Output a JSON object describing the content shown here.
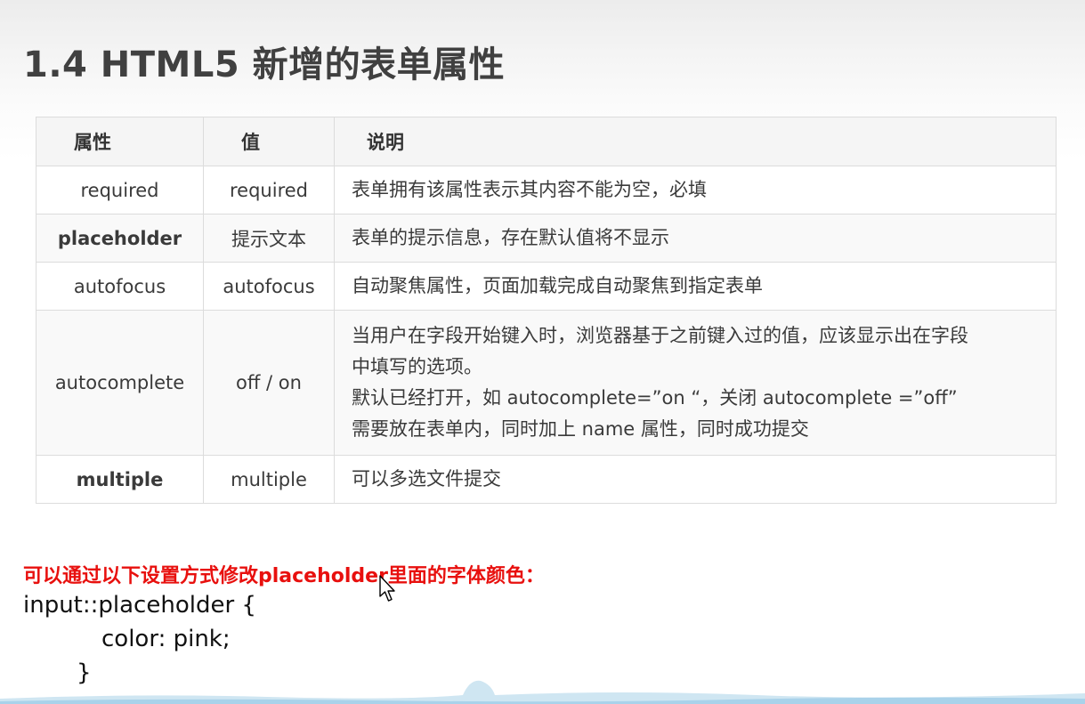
{
  "title": "1.4 HTML5 新增的表单属性",
  "table": {
    "headers": [
      "属性",
      "值",
      "说明"
    ],
    "rows": [
      {
        "attr": "required",
        "value": "required",
        "desc": [
          "表单拥有该属性表示其内容不能为空，必填"
        ],
        "bold": false
      },
      {
        "attr": "placeholder",
        "value": "提示文本",
        "desc": [
          "表单的提示信息，存在默认值将不显示"
        ],
        "bold": true
      },
      {
        "attr": "autofocus",
        "value": "autofocus",
        "desc": [
          "自动聚焦属性，页面加载完成自动聚焦到指定表单"
        ],
        "bold": false
      },
      {
        "attr": "autocomplete",
        "value": "off / on",
        "desc": [
          "当用户在字段开始键入时，浏览器基于之前键入过的值，应该显示出在字段",
          "中填写的选项。",
          "默认已经打开，如 autocomplete=”on “，关闭 autocomplete =”off”",
          "需要放在表单内，同时加上 name 属性，同时成功提交"
        ],
        "bold": false
      },
      {
        "attr": "multiple",
        "value": "multiple",
        "desc": [
          "可以多选文件提交"
        ],
        "bold": true
      }
    ]
  },
  "note": "可以通过以下设置方式修改placeholder里面的字体颜色：",
  "code": {
    "line1": "input::placeholder {",
    "line2": "color: pink;",
    "line3": "}"
  },
  "colors": {
    "note": "#e8100e",
    "title": "#404040",
    "table_border": "#dcdcdc"
  }
}
